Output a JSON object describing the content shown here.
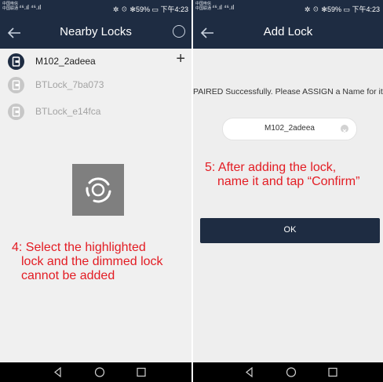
{
  "left": {
    "status": {
      "carrier_line1": "中国电信",
      "carrier_line2": "中国联通",
      "signal": "⁴⁶.ıl ⁴⁶.ıl",
      "right": "✲ ☉ ✻59% ▭ 下午4:23"
    },
    "header": {
      "title": "Nearby Locks"
    },
    "locks": [
      {
        "name": "M102_2adeea",
        "state": "active"
      },
      {
        "name": "BTLock_7ba073",
        "state": "dimmed"
      },
      {
        "name": "BTLock_e14fca",
        "state": "dimmed"
      }
    ],
    "annotation": [
      "4: Select the highlighted",
      "lock and the dimmed lock",
      "cannot be added"
    ]
  },
  "right": {
    "status": {
      "carrier_line1": "中国电信",
      "carrier_line2": "中国联通",
      "signal": "⁴⁶.ıl ⁴⁶.ıl",
      "right": "✲ ☉ ✻59% ▭ 下午4:23"
    },
    "header": {
      "title": "Add Lock"
    },
    "message": "PAIRED Successfully. Please ASSIGN a Name for it",
    "name_input": {
      "value": "M102_2adeea"
    },
    "annotation": [
      "5: After adding the lock,",
      "name it and tap “Confirm”"
    ],
    "ok_label": "OK"
  },
  "colors": {
    "primary": "#1e2c42",
    "annotation": "#e31c23",
    "loader": "#7f7f7f",
    "dimmed": "#c7c7c7"
  },
  "icons": [
    "back-arrow-icon",
    "scan-icon",
    "lock-icon",
    "add-icon",
    "loading-icon",
    "clear-icon",
    "nav-back-icon",
    "nav-home-icon",
    "nav-recents-icon"
  ]
}
